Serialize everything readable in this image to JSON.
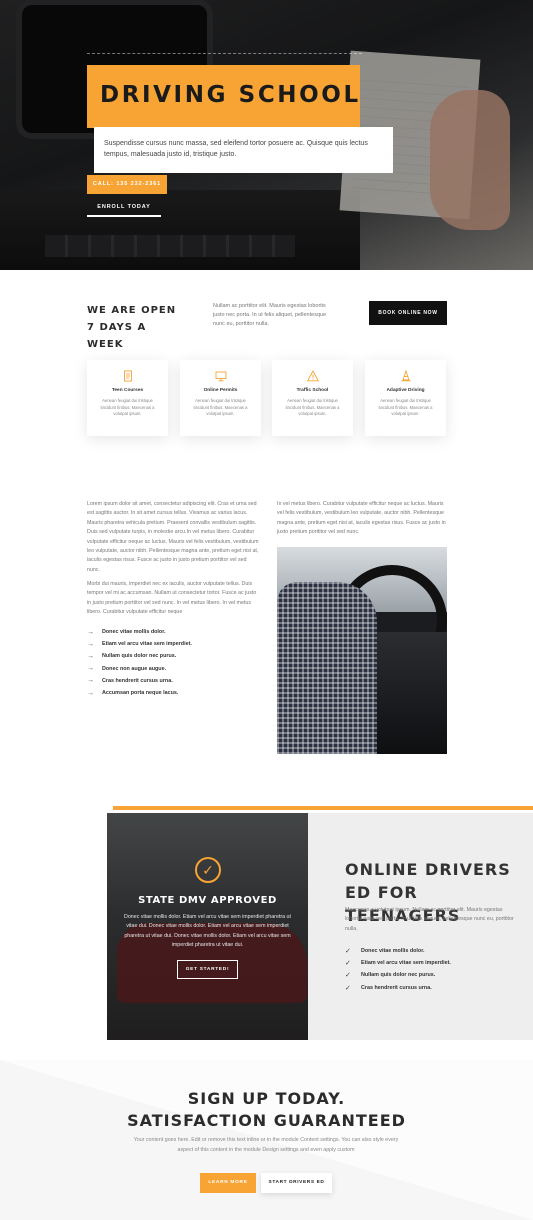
{
  "hero": {
    "title": "DRIVING SCHOOL",
    "description": "Suspendisse cursus nunc massa, sed eleifend tortor posuere ac. Quisque quis lectus tempus, malesuada justo id, tristique justo.",
    "call_label": "CALL: 135 232-2361",
    "enroll_label": "ENROLL TODAY"
  },
  "open": {
    "title": "WE ARE OPEN 7 DAYS A WEEK",
    "text": "Nullam ac porttitor elit. Mauris egestas lobortis justo nec porta. In ut felis aliquet, pellentesque nunc eu, porttitor nulla.",
    "book_label": "BOOK ONLINE NOW"
  },
  "services": [
    {
      "icon": "document-icon",
      "title": "Teen Courses",
      "text": "Aenean feugiat dui tristique tincidunt finibus. Maecenas a volutpat ipsum."
    },
    {
      "icon": "monitor-icon",
      "title": "Online Permits",
      "text": "Aenean feugiat dui tristique tincidunt finibus. Maecenas a volutpat ipsum."
    },
    {
      "icon": "warning-sign-icon",
      "title": "Traffic School",
      "text": "Aenean feugiat dui tristique tincidunt finibus. Maecenas a volutpat ipsum."
    },
    {
      "icon": "traffic-cone-icon",
      "title": "Adaptive Driving",
      "text": "Aenean feugiat dui tristique tincidunt finibus. Maecenas a volutpat ipsum."
    }
  ],
  "content": {
    "left_p1": "Lorem ipsum dolor sit amet, consectetur adipiscing elit. Cras et urna sed est sagittis auctor. In sit amet cursus tellus. Vivamus ac varius lacus. Mauris pharetra vehicula pretium. Praesent convallis vestibulum sagittis. Duis sed vulputate turpis, in molestie arcu.In vel metus libero. Curabitur vulputate efficitur neque ac luctus. Mauris vel felis vestibulum, vestibulum leo vulputate, auctor nibh. Pellentesque magna ante, pretium eget nisi at, iaculis egestas risus. Fusce ac justo in justo pretium porttitor vel sed nunc.",
    "left_p2": "Morbi dui mauris, imperdiet nec ex iaculis, auctor vulputate tellus. Duis tempor vel mi ac accumsan. Nullam ut consectetur tortor. Fusce ac justo in justo pretium porttitor vel sed nunc. In vel metus libero. In vel metus libero. Curabitur vulputate efficitur neque",
    "checklist": [
      "Donec vitae mollis dolor.",
      "Etiam vel arcu vitae sem imperdiet.",
      "Nullam quis dolor nec purus.",
      "Donec non augue augue.",
      "Cras hendrerit cursus urna.",
      "Accumsan porta neque lacus."
    ],
    "right_p1": "In vel metus libero. Curabitur vulputate efficitur neque ac luctus. Mauris vel felis vestibulum, vestibulum leo vulputate, auctor nibh. Pellentesque magna ante, pretium eget nisi at, iaculis egestas risus. Fusce ac justo in justo pretium porttitor vel sed nunc."
  },
  "dmv": {
    "title": "STATE DMV APPROVED",
    "text": "Donec vitae mollis dolor. Etiam vel arcu vitae sem imperdiet pharetra ut vitae dui. Donec vitae mollis dolor. Etiam vel arcu vitae sem imperdiet pharetra ut vitae dui. Donec vitae mollis dolor. Etiam vel arcu vitae sem imperdiet pharetra ut vitae dui.",
    "button_label": "GET STARTED!"
  },
  "drivers_ed": {
    "title": "ONLINE DRIVERS ED FOR TEENAGERS",
    "text": "Maecenas a volutpat ipsum. Nullam ac porttitor elit. Mauris egestas lobortis justo nec porta. In ut felis aliquet, pellentesque nunc eu, porttitor nulla.",
    "checklist": [
      "Donec vitae mollis dolor.",
      "Etiam vel arcu vitae sem imperdiet.",
      "Nullam quis dolor nec purus.",
      "Cras hendrerit cursus urna."
    ]
  },
  "signup": {
    "title_line1": "SIGN UP TODAY.",
    "title_line2": "SATISFACTION GUARANTEED",
    "text": "Your content goes here. Edit or remove this text inline or in the module Content settings. You can also style every aspect of this content in the module Design settings and even apply custom",
    "learn_label": "LEARN MORE",
    "start_label": "START DRIVERS ED"
  },
  "colors": {
    "accent": "#f7a435",
    "dark": "#111111"
  }
}
